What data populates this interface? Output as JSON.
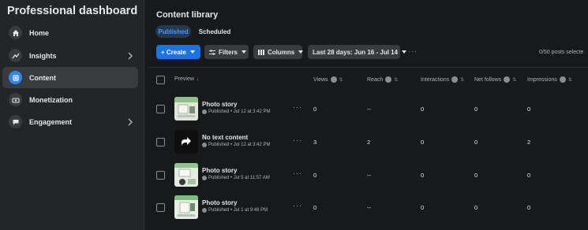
{
  "sidebar": {
    "title": "Professional dashboard",
    "items": [
      {
        "label": "Home",
        "icon": "home-icon",
        "chevron": false,
        "active": false
      },
      {
        "label": "Insights",
        "icon": "insights-icon",
        "chevron": true,
        "active": false
      },
      {
        "label": "Content",
        "icon": "content-icon",
        "chevron": false,
        "active": true
      },
      {
        "label": "Monetization",
        "icon": "monetization-icon",
        "chevron": false,
        "active": false
      },
      {
        "label": "Engagement",
        "icon": "engagement-icon",
        "chevron": true,
        "active": false
      }
    ]
  },
  "main": {
    "title": "Content library",
    "tabs": [
      {
        "label": "Published",
        "active": true
      },
      {
        "label": "Scheduled",
        "active": false
      }
    ],
    "toolbar": {
      "create_label": "+ Create",
      "filters_label": "Filters",
      "columns_label": "Columns",
      "date_range_label": "Last 28 days: Jun 16 - Jul 14",
      "more_label": "···",
      "post_count": "0/50 posts selecte"
    },
    "columns": {
      "preview": "Preview",
      "views": "Views",
      "reach": "Reach",
      "interactions": "Interactions",
      "net_follows": "Net follows",
      "impressions": "Impressions"
    },
    "rows": [
      {
        "title": "Photo story",
        "meta": "Published • Jul 12 at 3:42 PM",
        "views": "0",
        "reach": "--",
        "interactions": "0",
        "net_follows": "0",
        "impressions": "0",
        "thumb": "photo"
      },
      {
        "title": "No text content",
        "meta": "Published • Jul 12 at 3:42 PM",
        "views": "3",
        "reach": "2",
        "interactions": "0",
        "net_follows": "0",
        "impressions": "2",
        "thumb": "share"
      },
      {
        "title": "Photo story",
        "meta": "Published • Jul 5 at 11:57 AM",
        "views": "0",
        "reach": "--",
        "interactions": "0",
        "net_follows": "0",
        "impressions": "0",
        "thumb": "photo"
      },
      {
        "title": "Photo story",
        "meta": "Published • Jul 1 at 9:48 PM",
        "views": "0",
        "reach": "--",
        "interactions": "0",
        "net_follows": "0",
        "impressions": "0",
        "thumb": "photo"
      }
    ],
    "row_more_label": "···"
  },
  "colors": {
    "accent": "#1b74e4",
    "tab_active_text": "#4599ff",
    "background": "#18191a",
    "sidebar_bg": "#242526"
  }
}
